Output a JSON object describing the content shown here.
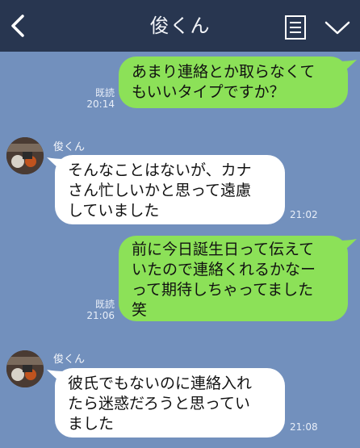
{
  "header": {
    "title": "俊くん"
  },
  "messages": [
    {
      "direction": "out",
      "text": "あまり連絡とか取らなくて\nもいいタイプですか？",
      "read": "既読",
      "time": "20:14"
    },
    {
      "direction": "in",
      "sender": "俊くん",
      "text": "そんなことはないが、カナ\nさん忙しいかと思って遠慮\nしていました",
      "time": "21:02"
    },
    {
      "direction": "out",
      "text": "前に今日誕生日って伝えて\nいたので連絡くれるかなー\nって期待しちゃってました\n笑",
      "read": "既読",
      "time": "21:06"
    },
    {
      "direction": "in",
      "sender": "俊くん",
      "text": "彼氏でもないのに連絡入れ\nたら迷惑だろうと思ってい\nました",
      "time": "21:08"
    }
  ],
  "colors": {
    "background": "#7290bd",
    "header": "#283650",
    "outgoing_bubble": "#8ce158",
    "incoming_bubble": "#ffffff"
  }
}
